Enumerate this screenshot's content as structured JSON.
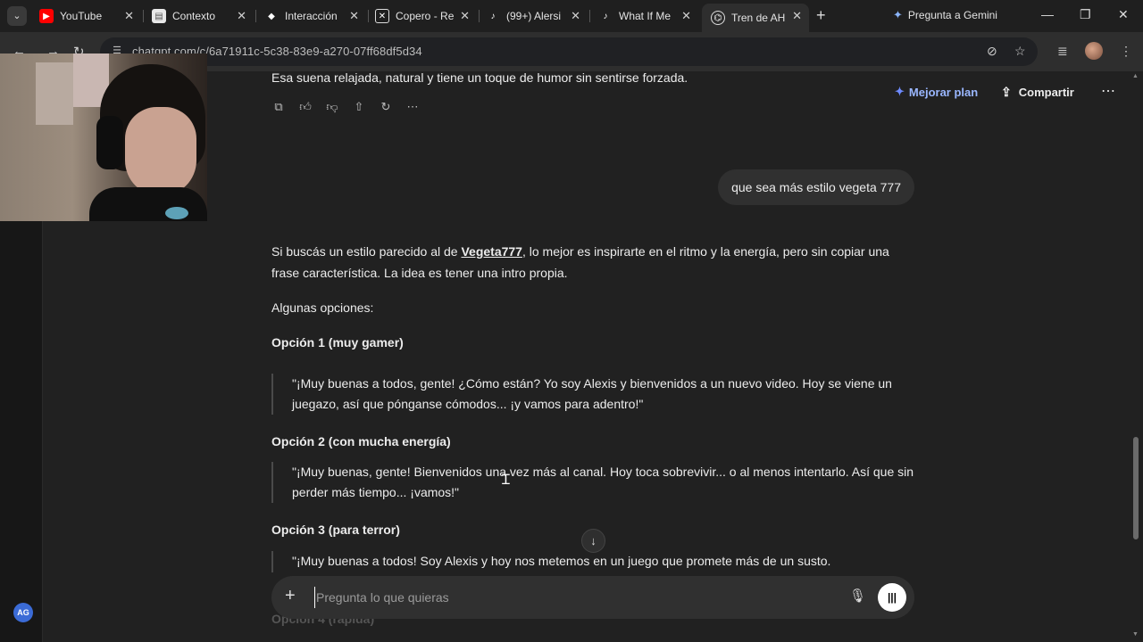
{
  "tabs": [
    {
      "title": "YouTube",
      "favicon": "youtube-icon",
      "color": "#ff0000"
    },
    {
      "title": "Contexto",
      "favicon": "docs-icon",
      "color": "#dcdcdc"
    },
    {
      "title": "Interacción",
      "favicon": "diamond-icon",
      "color": "#ffffff"
    },
    {
      "title": "Copero - Re",
      "favicon": "x-square-icon",
      "color": "#ffffff"
    },
    {
      "title": "(99+) Alersi",
      "favicon": "tiktok-icon",
      "color": "#ffffff"
    },
    {
      "title": "What If Me",
      "favicon": "tiktok-icon",
      "color": "#ffffff"
    },
    {
      "title": "Tren de AH",
      "favicon": "chatgpt-icon",
      "color": "#ffffff",
      "active": true
    }
  ],
  "gemini_label": "Pregunta a Gemini",
  "address": {
    "url": "chatgpt.com/c/6a71911c-5c38-83e9-a270-07ff68df5d34"
  },
  "header": {
    "upgrade_label": "Mejorar plan",
    "share_label": "Compartir"
  },
  "conversation": {
    "prev_assistant_tail": "Esa suena relajada, natural y tiene un toque de humor sin sentirse forzada.",
    "user_message": "que sea más estilo vegeta 777",
    "reply_intro_before": "Si buscás un estilo parecido al de ",
    "reply_intro_link": "Vegeta777",
    "reply_intro_after": ", lo mejor es inspirarte en el ritmo y la energía, pero sin copiar una frase característica. La idea es tener una intro propia.",
    "options_label": "Algunas opciones:",
    "options": [
      {
        "heading": "Opción 1 (muy gamer)",
        "quote": "\"¡Muy buenas a todos, gente! ¿Cómo están? Yo soy Alexis y bienvenidos a un nuevo video. Hoy se viene un juegazo, así que pónganse cómodos... ¡y vamos para adentro!\""
      },
      {
        "heading": "Opción 2 (con mucha energía)",
        "quote": "\"¡Muy buenas, gente! Bienvenidos una vez más al canal. Hoy toca sobrevivir... o al menos intentarlo. Así que sin perder más tiempo... ¡vamos!\""
      },
      {
        "heading": "Opción 3 (para terror)",
        "quote": "\"¡Muy buenas a todos! Soy Alexis y hoy nos metemos en un juego que promete más de un susto."
      },
      {
        "heading": "Opción 4 (rápida)",
        "quote": ""
      }
    ]
  },
  "composer": {
    "placeholder": "Pregunta lo que quieras"
  },
  "user_avatar_initials": "AG"
}
